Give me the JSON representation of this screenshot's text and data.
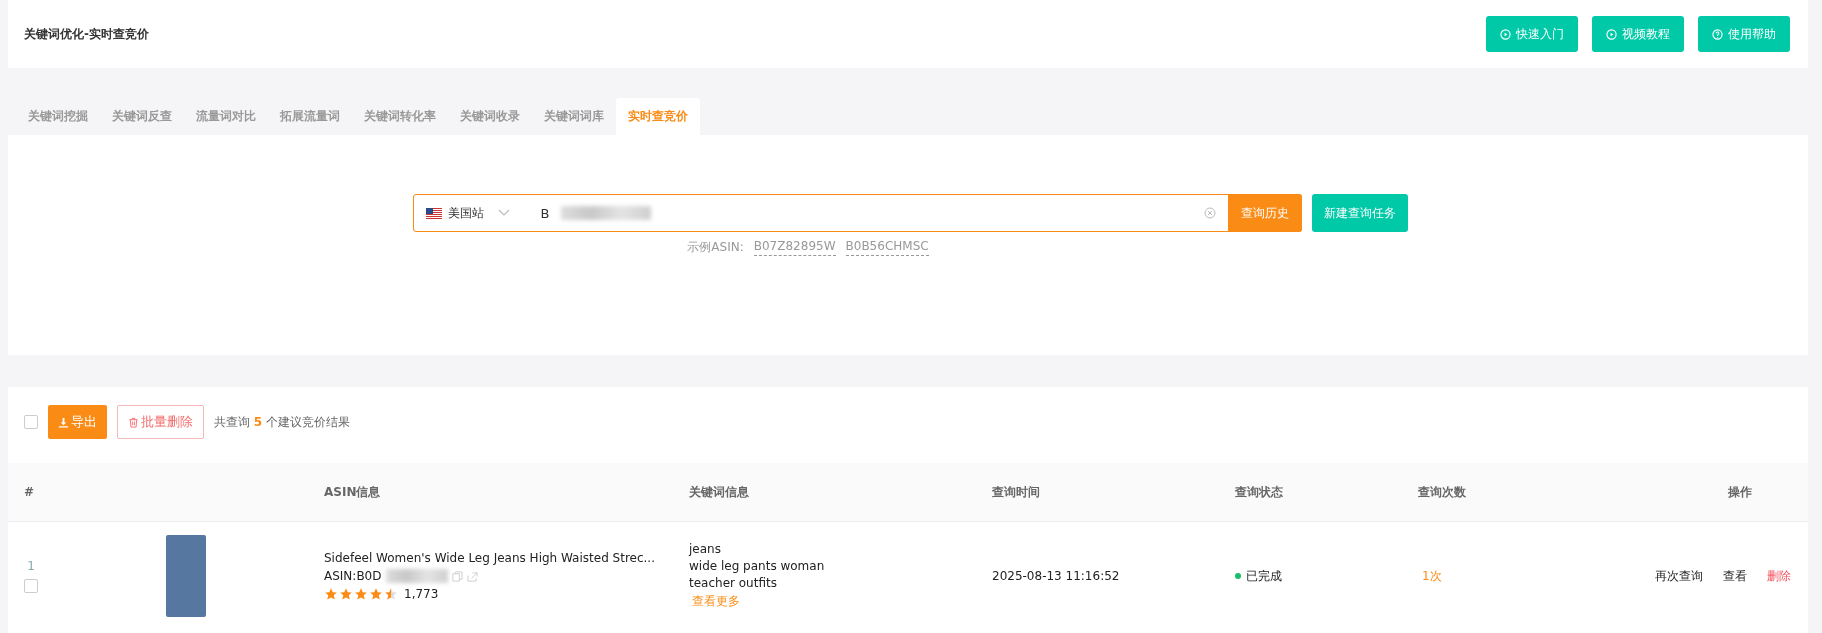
{
  "header": {
    "title": "关键词优化-实时查竞价",
    "buttons": [
      {
        "kind": "play",
        "label": "快速入门"
      },
      {
        "kind": "play",
        "label": "视频教程"
      },
      {
        "kind": "help",
        "label": "使用帮助"
      }
    ]
  },
  "tabs": [
    {
      "label": "关键词挖掘",
      "selected": false
    },
    {
      "label": "关键词反查",
      "selected": false
    },
    {
      "label": "流量词对比",
      "selected": false
    },
    {
      "label": "拓展流量词",
      "selected": false
    },
    {
      "label": "关键词转化率",
      "selected": false
    },
    {
      "label": "关键词收录",
      "selected": false
    },
    {
      "label": "关键词词库",
      "selected": false
    },
    {
      "label": "实时查竞价",
      "selected": true
    }
  ],
  "search": {
    "marketplace": "美国站",
    "value": "B",
    "history_button": "查询历史",
    "new_task_button": "新建查询任务",
    "example_label": "示例ASIN:",
    "examples": [
      "B07Z82895W",
      "B0B56CHMSC"
    ]
  },
  "toolbar": {
    "select_all_checked": false,
    "export_button": "导出",
    "batch_delete_button": "批量删除",
    "summary_prefix": "共查询",
    "summary_count": "5",
    "summary_suffix": "个建议竞价结果"
  },
  "table": {
    "columns": [
      "#",
      "ASIN信息",
      "关键词信息",
      "查询时间",
      "查询状态",
      "查询次数",
      "操作"
    ],
    "rows": [
      {
        "index": "1",
        "checked": false,
        "title": "Sidefeel Women's Wide Leg Jeans High Waisted Strec...",
        "asin": "ASIN:B0D",
        "stars": 4.5,
        "rating_count": "1,773",
        "keywords": [
          "jeans",
          "wide leg pants woman",
          "teacher outfits"
        ],
        "more": "查看更多",
        "time": "2025-08-13 11:16:52",
        "status": "已完成",
        "color": "#19be6b",
        "count": "1次",
        "actions": [
          {
            "kind": "normal",
            "label": "再次查询"
          },
          {
            "kind": "normal",
            "label": "查看"
          },
          {
            "kind": "danger",
            "label": "删除"
          }
        ]
      }
    ]
  }
}
